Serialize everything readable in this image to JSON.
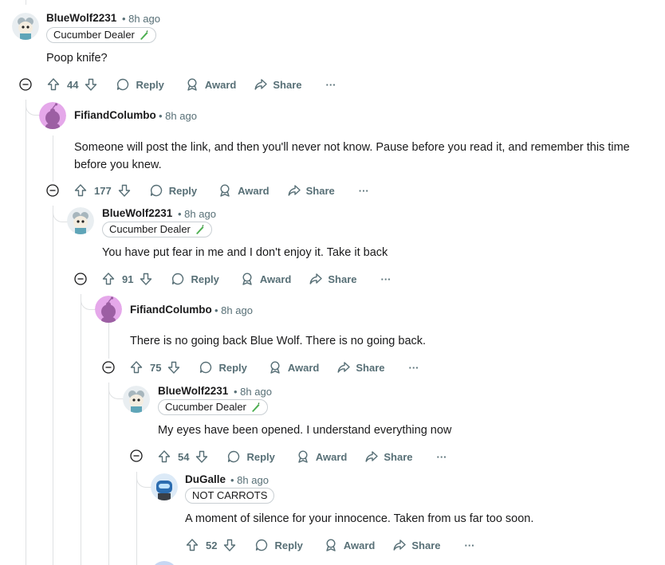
{
  "comments": [
    {
      "user": "BlueWolf2231",
      "time": "• 8h ago",
      "flair": "Cucumber Dealer",
      "body": "Poop knife?",
      "votes": "44"
    },
    {
      "user": "FifiandColumbo",
      "time": "• 8h ago",
      "body": "Someone will post the link, and then you'll never not know. Pause before you read it, and remember this time before you knew.",
      "votes": "177"
    },
    {
      "user": "BlueWolf2231",
      "time": "• 8h ago",
      "flair": "Cucumber Dealer",
      "body": "You have put fear in me and I don't enjoy it. Take it back",
      "votes": "91"
    },
    {
      "user": "FifiandColumbo",
      "time": "• 8h ago",
      "body": "There is no going back Blue Wolf. There is no going back.",
      "votes": "75"
    },
    {
      "user": "BlueWolf2231",
      "time": "• 8h ago",
      "flair": "Cucumber Dealer",
      "body": "My eyes have been opened. I understand everything now",
      "votes": "54"
    },
    {
      "user": "DuGalle",
      "time": "• 8h ago",
      "flair": "NOT CARROTS",
      "body": "A moment of silence for your innocence. Taken from us far too soon.",
      "votes": "52"
    }
  ],
  "actions": {
    "reply": "Reply",
    "award": "Award",
    "share": "Share",
    "more": "···"
  },
  "colors": {
    "accent": "#0079d3",
    "muted": "#576f76",
    "rail": "#dfe1e3",
    "snoo_pink": "#e5a8ea"
  }
}
